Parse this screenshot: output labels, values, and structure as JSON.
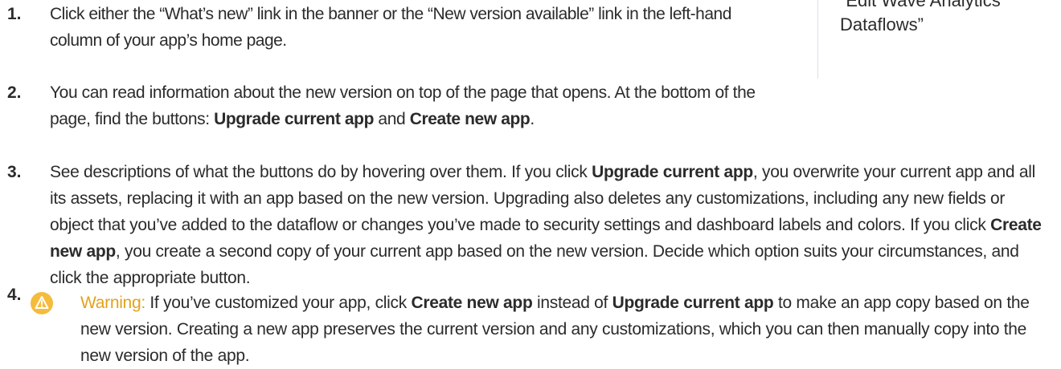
{
  "sidebar": {
    "link_line1": "“Edit Wave Analytics",
    "link_line2": "Dataflows”"
  },
  "steps": [
    {
      "number": "1.",
      "parts": [
        "Click either the “What’s new” link in the banner or the “New version available” link in the left-hand column of your app’s home page."
      ]
    },
    {
      "number": "2.",
      "parts": [
        "You can read information about the new version on top of the page that opens. At the bottom of the page, find the buttons: ",
        "Upgrade current app",
        " and ",
        "Create new app",
        "."
      ]
    },
    {
      "number": "3.",
      "parts": [
        "See descriptions of what the buttons do by hovering over them. If you click ",
        "Upgrade current app",
        ", you overwrite your current app and all its assets, replacing it with an app based on the new version. Upgrading also deletes any customizations, including any new fields or object that you’ve added to the dataflow or changes you’ve made to security settings and dashboard labels and colors. If you click ",
        "Create new app",
        ", you create a second copy of your current app based on the new version. Decide which option suits your circumstances, and click the appropriate button."
      ]
    },
    {
      "number": "4.",
      "warning_label": "Warning:",
      "parts": [
        " If you’ve customized your app, click ",
        "Create new app",
        " instead of ",
        "Upgrade current app",
        " to make an app copy based on the new version. Creating a new app preserves the current version and any customizations, which you can then manually copy into the new version of the app."
      ]
    }
  ],
  "icons": {
    "warning": "warning-icon"
  },
  "colors": {
    "warning": "#e3a21a",
    "warning_icon_bg": "#f4bc3c",
    "text": "#2b2b2b",
    "sidebar_rule": "#d6e2ec"
  }
}
